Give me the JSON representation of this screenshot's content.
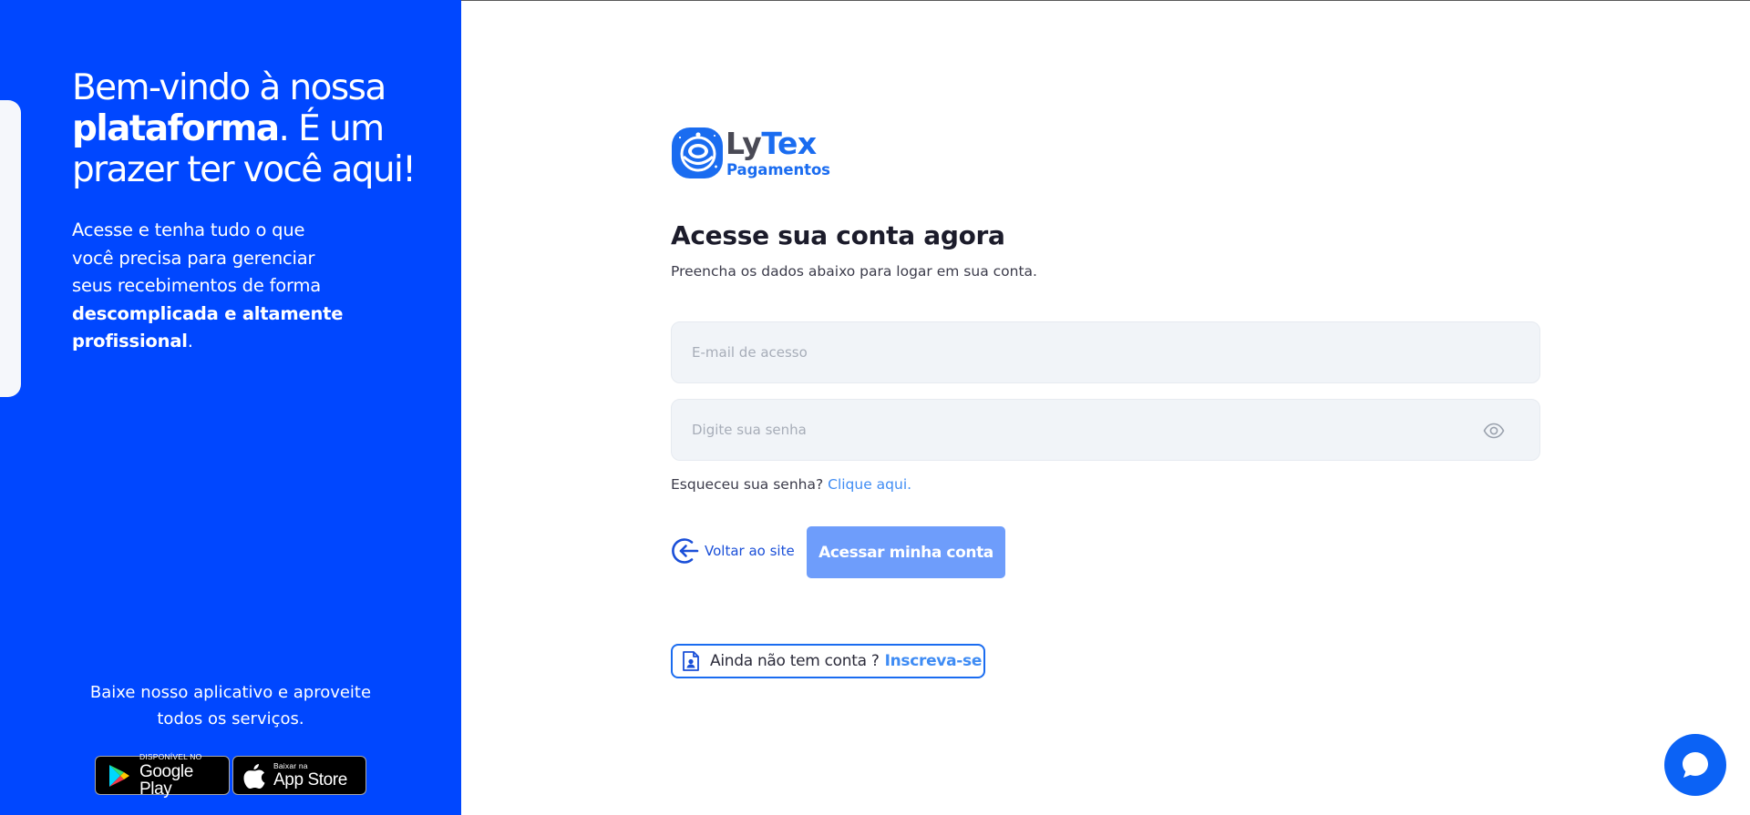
{
  "left_panel": {
    "welcome_part1": "Bem-vindo à nossa ",
    "welcome_bold": "plataforma",
    "welcome_part2": ". É um prazer ter você aqui!",
    "desc_part1": "Acesse e tenha tudo o que você precisa para gerenciar seus recebimentos de forma ",
    "desc_bold": "descomplicada e altamente profissional",
    "desc_part2": ".",
    "app_text": "Baixe nosso aplicativo e aproveite todos os serviços.",
    "google_play": {
      "small": "DISPONÍVEL NO",
      "big": "Google Play"
    },
    "app_store": {
      "small": "Baixar na",
      "big": "App Store"
    }
  },
  "logo": {
    "name_part1": "Ly",
    "name_part2": "Tex",
    "subtitle": "Pagamentos"
  },
  "form": {
    "title": "Acesse sua conta agora",
    "subtitle": "Preencha os dados abaixo para logar em sua conta.",
    "email_value": "",
    "email_placeholder": "E-mail de acesso",
    "password_value": "",
    "password_placeholder": "Digite sua senha",
    "forgot_text": "Esqueceu sua senha?",
    "forgot_link": "Clique aqui.",
    "back_label": "Voltar ao site",
    "login_label": "Acessar minha conta",
    "signup_question": "Ainda não tem conta ?",
    "signup_link": "Inscreva-se"
  },
  "colors": {
    "panel_blue": "#0047ff",
    "brand_blue": "#1a6cf0",
    "link_blue": "#3f8cf4",
    "button_blue": "#6e9dfb",
    "field_bg": "#f1f4f8"
  },
  "icons": {
    "eye": "eye-icon",
    "back": "arrow-left-circle-icon",
    "signup": "user-document-icon",
    "chat": "chat-bubble-icon",
    "google_play": "google-play-icon",
    "apple": "apple-icon"
  }
}
